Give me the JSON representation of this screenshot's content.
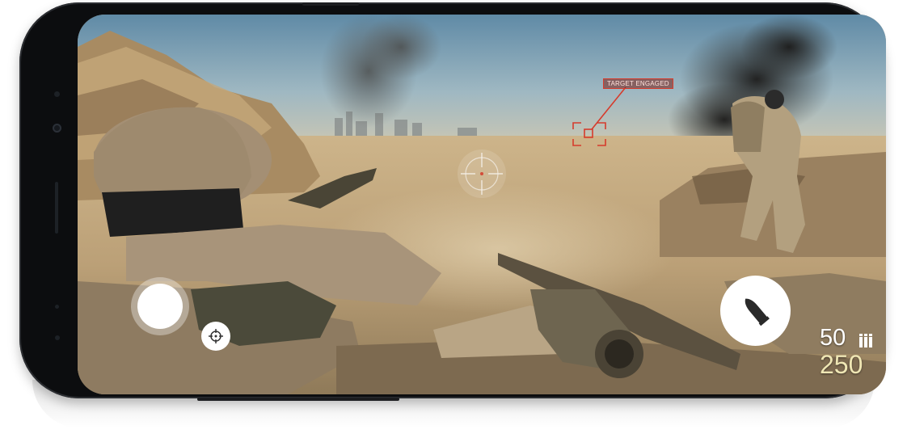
{
  "hud": {
    "target_label": "TARGET ENGAGED",
    "ammo_magazine": "50",
    "ammo_reserve": "250",
    "accent_color": "#d63b2c",
    "ammo_reserve_color": "#efe6b4"
  },
  "controls": {
    "shoot_icon": "circle-fire-button",
    "aim_icon": "crosshair-icon",
    "reload_icon": "bullet-icon",
    "ammo_icon": "ammo-bars-icon"
  }
}
